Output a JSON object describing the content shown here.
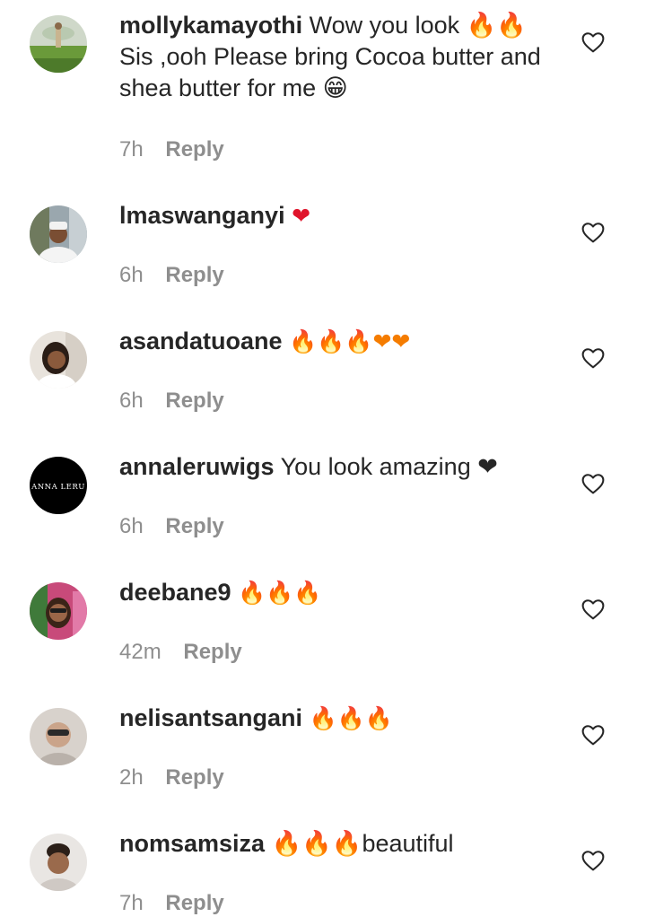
{
  "comments": [
    {
      "username": "mollykamayothi",
      "text": "Wow you look 🔥🔥 Sis ,ooh Please bring Cocoa butter and shea butter for me 😁",
      "time": "7h",
      "reply_label": "Reply"
    },
    {
      "username": "lmaswanganyi",
      "text": "❤",
      "time": "6h",
      "reply_label": "Reply"
    },
    {
      "username": "asandatuoane",
      "text": "🔥🔥🔥❤❤",
      "time": "6h",
      "reply_label": "Reply"
    },
    {
      "username": "annaleruwigs",
      "text": "You look amazing ❤",
      "avatar_text": "ANNA LERU",
      "time": "6h",
      "reply_label": "Reply"
    },
    {
      "username": "deebane9",
      "text": "🔥🔥🔥",
      "time": "42m",
      "reply_label": "Reply"
    },
    {
      "username": "nelisantsangani",
      "text": "🔥🔥🔥",
      "time": "2h",
      "reply_label": "Reply"
    },
    {
      "username": "nomsamsiza",
      "text": "🔥🔥🔥beautiful",
      "time": "7h",
      "reply_label": "Reply"
    }
  ],
  "icons": {
    "like": "heart-outline-icon"
  },
  "colors": {
    "text": "#262626",
    "secondary": "#8e8e8e",
    "fire": "#f57c00",
    "heart": "#e0142b"
  }
}
